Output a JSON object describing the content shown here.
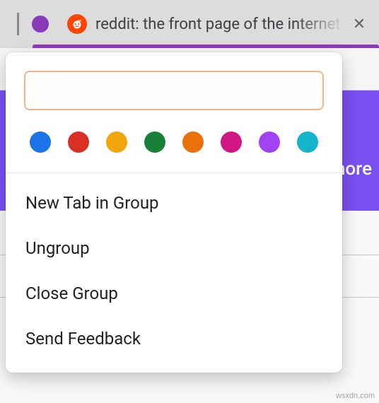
{
  "colors": {
    "group_accent": "#8a3ab9",
    "banner": "#7b4ff0"
  },
  "tab": {
    "title": "reddit: the front page of the internet",
    "favicon": "reddit"
  },
  "banner": {
    "text_fragment": "more"
  },
  "popover": {
    "name_input": {
      "value": "",
      "placeholder": ""
    },
    "swatches": [
      {
        "name": "blue",
        "hex": "#1a73e8"
      },
      {
        "name": "red",
        "hex": "#d93025"
      },
      {
        "name": "yellow",
        "hex": "#f2a60d"
      },
      {
        "name": "green",
        "hex": "#188038"
      },
      {
        "name": "orange",
        "hex": "#e8710a"
      },
      {
        "name": "pink",
        "hex": "#d01884"
      },
      {
        "name": "purple",
        "hex": "#a142f4"
      },
      {
        "name": "cyan",
        "hex": "#12b5cb"
      }
    ],
    "menu": {
      "new_tab": "New Tab in Group",
      "ungroup": "Ungroup",
      "close_group": "Close Group",
      "send_feedback": "Send Feedback"
    }
  },
  "watermark": "wsxdn.com"
}
